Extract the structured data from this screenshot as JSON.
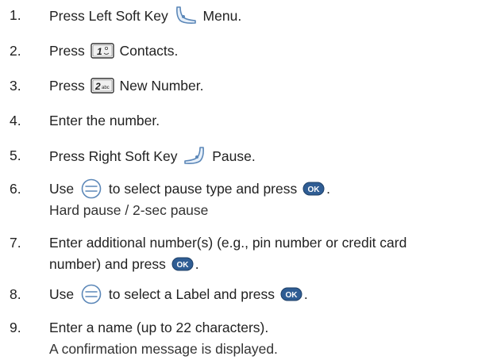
{
  "steps": [
    {
      "n": "1.",
      "a": "Press Left Soft Key",
      "icon": "left-soft-key-icon",
      "b": "Menu."
    },
    {
      "n": "2.",
      "a": "Press",
      "icon": "key-1-icon",
      "key": "1",
      "b": "Contacts."
    },
    {
      "n": "3.",
      "a": "Press",
      "icon": "key-2abc-icon",
      "key": "2",
      "keysub": "abc",
      "b": "New Number."
    },
    {
      "n": "4.",
      "a": "Enter the number."
    },
    {
      "n": "5.",
      "a": "Press Right Soft Key",
      "icon": "right-soft-key-icon",
      "b": "Pause."
    },
    {
      "n": "6.",
      "a": "Use",
      "icon": "nav-key-icon",
      "b": "to select pause type and press",
      "ok": "OK",
      "c": ".",
      "sub": "Hard pause / 2-sec pause"
    },
    {
      "n": "7.",
      "a": "Enter additional number(s) (e.g., pin number or credit card",
      "a2": "number) and press",
      "ok": "OK",
      "c": "."
    },
    {
      "n": "8.",
      "a": "Use",
      "icon": "nav-key-icon",
      "b": "to select a Label and press",
      "ok": "OK",
      "c": "."
    },
    {
      "n": "9.",
      "a": "Enter a name (up to 22 characters).",
      "sub": "A confirmation message is displayed."
    }
  ],
  "colors": {
    "icon_outline": "#5b87b8",
    "icon_fill": "#e7f0fa",
    "ok_fill": "#2f5d94",
    "ok_text": "#ffffff"
  }
}
